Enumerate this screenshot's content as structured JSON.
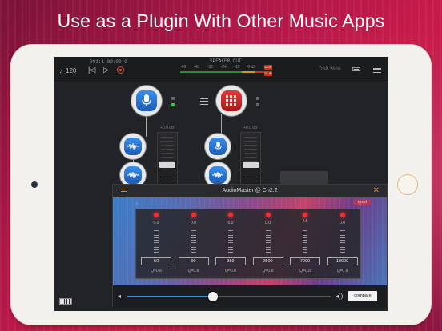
{
  "headline": "Use as a Plugin With Other Music Apps",
  "topbar": {
    "tempo": "♩120",
    "position": "001:1  00:00.0",
    "speaker_out": "SPEAKER OUT",
    "meter_ticks": [
      "-60",
      "-48",
      "-36",
      "-24",
      "-12",
      "0 dB",
      "+6"
    ],
    "clip_l": "CLIP",
    "clip_r": "CLIP",
    "dsp": "DSP 26 %"
  },
  "channels": [
    {
      "db": "+0.0 dB"
    },
    {
      "db": "+0.0 dB"
    }
  ],
  "plugin": {
    "title": "AudioMaster @ Ch2:2",
    "reset_label": "reset",
    "compare_label": "compare",
    "volume_level": 0.42,
    "bands": [
      {
        "gain": "0.0",
        "freq": "50",
        "q": "Q=0.8"
      },
      {
        "gain": "0.0",
        "freq": "90",
        "q": "Q=0.8"
      },
      {
        "gain": "0.0",
        "freq": "350",
        "q": "Q=0.8"
      },
      {
        "gain": "0.0",
        "freq": "2500",
        "q": "Q=0.8"
      },
      {
        "gain": "4.5",
        "freq": "7000",
        "q": "Q=0.8"
      },
      {
        "gain": "0.0",
        "freq": "10000",
        "q": "Q=0.8"
      }
    ]
  },
  "colors": {
    "accent": "#d08a3a",
    "led": "#ff2a2a",
    "slider": "#3a8ede"
  }
}
